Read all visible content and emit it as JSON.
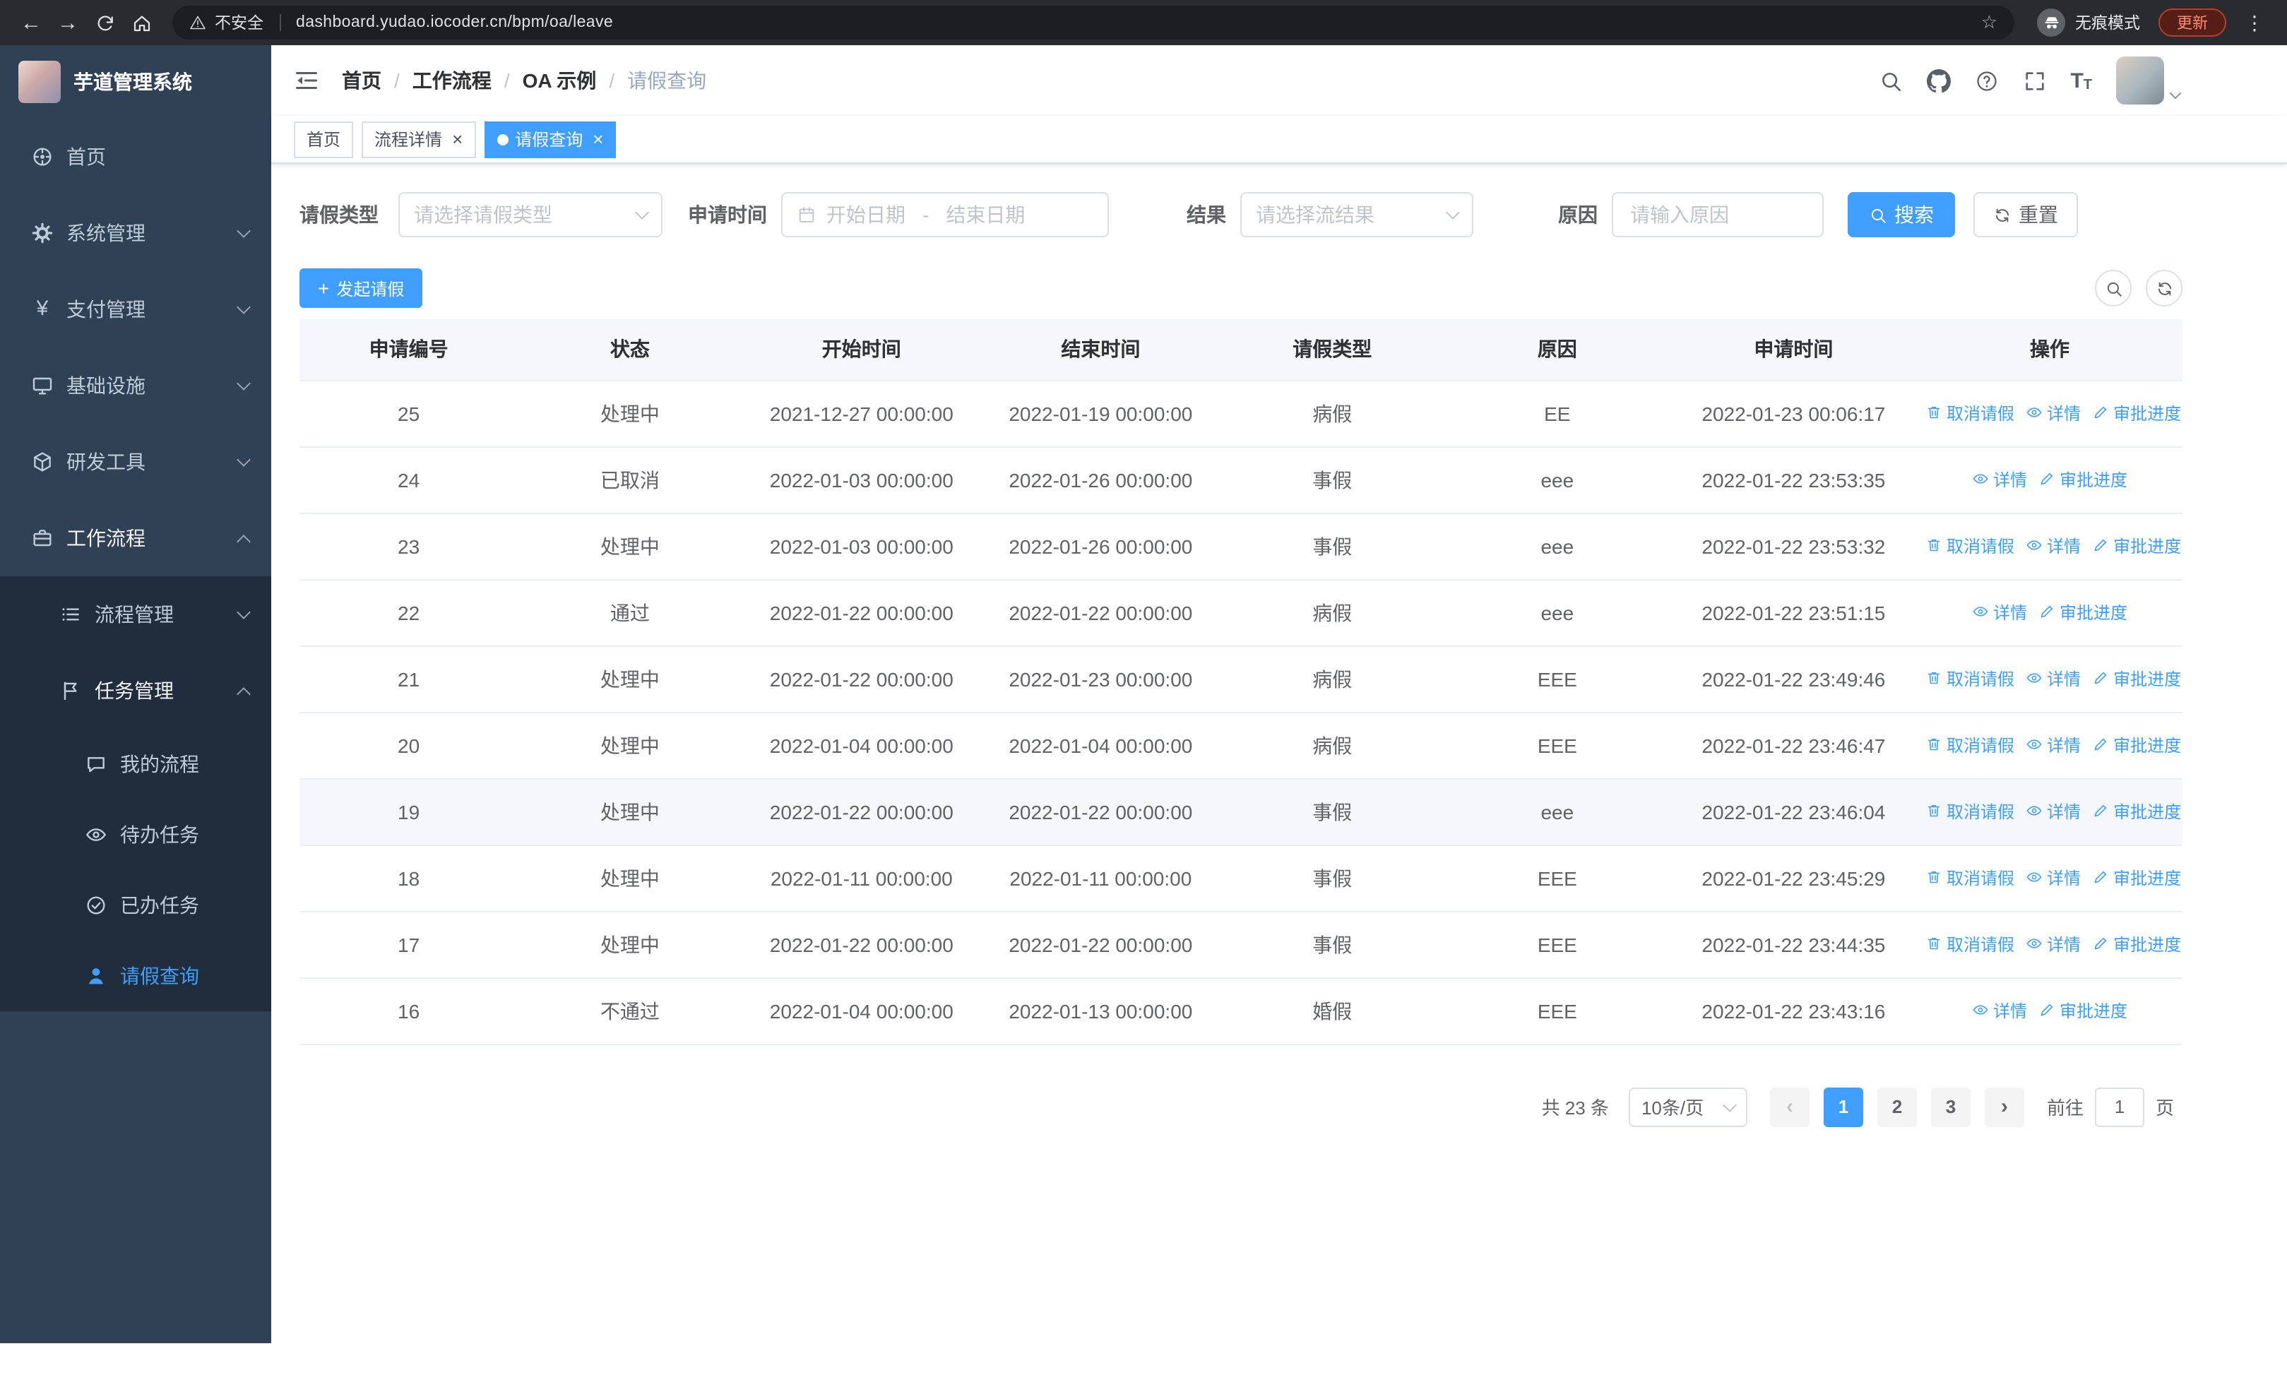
{
  "colors": {
    "accent": "#409eff",
    "sidebar_bg": "#304156",
    "sidebar_submenu_bg": "#1f2d3d",
    "sidebar_text": "#bfcbd9",
    "link": "#409eff",
    "active_tab_bg": "#409eff"
  },
  "browser": {
    "security_label": "不安全",
    "url": "dashboard.yudao.iocoder.cn/bpm/oa/leave",
    "incognito_label": "无痕模式",
    "update_label": "更新"
  },
  "sidebar": {
    "logo_title": "芋道管理系统",
    "menu": [
      {
        "key": "home",
        "label": "首页",
        "icon": "dashboard-icon",
        "level": 1
      },
      {
        "key": "system",
        "label": "系统管理",
        "icon": "gear-icon",
        "level": 1,
        "arrow": "down"
      },
      {
        "key": "payment",
        "label": "支付管理",
        "icon": "yen-icon",
        "level": 1,
        "arrow": "down"
      },
      {
        "key": "infrastructure",
        "label": "基础设施",
        "icon": "monitor-icon",
        "level": 1,
        "arrow": "down"
      },
      {
        "key": "devtools",
        "label": "研发工具",
        "icon": "cube-icon",
        "level": 1,
        "arrow": "down"
      },
      {
        "key": "workflow",
        "label": "工作流程",
        "icon": "briefcase-icon",
        "level": 1,
        "arrow": "up",
        "expanded": true
      },
      {
        "key": "process-management",
        "label": "流程管理",
        "icon": "list-icon",
        "level": 2,
        "arrow": "down"
      },
      {
        "key": "task-management",
        "label": "任务管理",
        "icon": "flag-icon",
        "level": 2,
        "arrow": "up",
        "expanded": true
      },
      {
        "key": "my-process",
        "label": "我的流程",
        "icon": "chat-icon",
        "level": 3
      },
      {
        "key": "todo-task",
        "label": "待办任务",
        "icon": "eye-icon",
        "level": 3
      },
      {
        "key": "done-task",
        "label": "已办任务",
        "icon": "check-circle-icon",
        "level": 3
      },
      {
        "key": "leave-query",
        "label": "请假查询",
        "icon": "user-icon",
        "level": 3,
        "active": true
      }
    ]
  },
  "header": {
    "breadcrumb": [
      "首页",
      "工作流程",
      "OA 示例",
      "请假查询"
    ],
    "icons": [
      "search-icon",
      "github-icon",
      "question-icon",
      "fullscreen-icon",
      "font-size-icon"
    ]
  },
  "tabs": [
    {
      "key": "home",
      "label": "首页",
      "closable": false,
      "active": false
    },
    {
      "key": "process-detail",
      "label": "流程详情",
      "closable": true,
      "active": false
    },
    {
      "key": "leave-query",
      "label": "请假查询",
      "closable": true,
      "active": true
    }
  ],
  "filters": {
    "leave_type": {
      "label": "请假类型",
      "placeholder": "请选择请假类型"
    },
    "apply_time": {
      "label": "申请时间",
      "start_placeholder": "开始日期",
      "separator": "-",
      "end_placeholder": "结束日期"
    },
    "result": {
      "label": "结果",
      "placeholder": "请选择流结果"
    },
    "reason": {
      "label": "原因",
      "placeholder": "请输入原因"
    },
    "search_label": "搜索",
    "reset_label": "重置"
  },
  "toolbar": {
    "create_label": "发起请假"
  },
  "table": {
    "columns": [
      "申请编号",
      "状态",
      "开始时间",
      "结束时间",
      "请假类型",
      "原因",
      "申请时间",
      "操作"
    ],
    "action_defs": {
      "cancel": {
        "label": "取消请假",
        "icon": "delete-icon"
      },
      "detail": {
        "label": "详情",
        "icon": "view-icon"
      },
      "progress": {
        "label": "审批进度",
        "icon": "edit-icon"
      }
    },
    "rows": [
      {
        "id": "25",
        "status": "处理中",
        "start": "2021-12-27 00:00:00",
        "end": "2022-01-19 00:00:00",
        "type": "病假",
        "reason": "EE",
        "applied": "2022-01-23 00:06:17",
        "actions": [
          "cancel",
          "detail",
          "progress"
        ]
      },
      {
        "id": "24",
        "status": "已取消",
        "start": "2022-01-03 00:00:00",
        "end": "2022-01-26 00:00:00",
        "type": "事假",
        "reason": "eee",
        "applied": "2022-01-22 23:53:35",
        "actions": [
          "detail",
          "progress"
        ]
      },
      {
        "id": "23",
        "status": "处理中",
        "start": "2022-01-03 00:00:00",
        "end": "2022-01-26 00:00:00",
        "type": "事假",
        "reason": "eee",
        "applied": "2022-01-22 23:53:32",
        "actions": [
          "cancel",
          "detail",
          "progress"
        ]
      },
      {
        "id": "22",
        "status": "通过",
        "start": "2022-01-22 00:00:00",
        "end": "2022-01-22 00:00:00",
        "type": "病假",
        "reason": "eee",
        "applied": "2022-01-22 23:51:15",
        "actions": [
          "detail",
          "progress"
        ]
      },
      {
        "id": "21",
        "status": "处理中",
        "start": "2022-01-22 00:00:00",
        "end": "2022-01-23 00:00:00",
        "type": "病假",
        "reason": "EEE",
        "applied": "2022-01-22 23:49:46",
        "actions": [
          "cancel",
          "detail",
          "progress"
        ]
      },
      {
        "id": "20",
        "status": "处理中",
        "start": "2022-01-04 00:00:00",
        "end": "2022-01-04 00:00:00",
        "type": "病假",
        "reason": "EEE",
        "applied": "2022-01-22 23:46:47",
        "actions": [
          "cancel",
          "detail",
          "progress"
        ]
      },
      {
        "id": "19",
        "status": "处理中",
        "start": "2022-01-22 00:00:00",
        "end": "2022-01-22 00:00:00",
        "type": "事假",
        "reason": "eee",
        "applied": "2022-01-22 23:46:04",
        "actions": [
          "cancel",
          "detail",
          "progress"
        ],
        "highlighted": true
      },
      {
        "id": "18",
        "status": "处理中",
        "start": "2022-01-11 00:00:00",
        "end": "2022-01-11 00:00:00",
        "type": "事假",
        "reason": "EEE",
        "applied": "2022-01-22 23:45:29",
        "actions": [
          "cancel",
          "detail",
          "progress"
        ]
      },
      {
        "id": "17",
        "status": "处理中",
        "start": "2022-01-22 00:00:00",
        "end": "2022-01-22 00:00:00",
        "type": "事假",
        "reason": "EEE",
        "applied": "2022-01-22 23:44:35",
        "actions": [
          "cancel",
          "detail",
          "progress"
        ]
      },
      {
        "id": "16",
        "status": "不通过",
        "start": "2022-01-04 00:00:00",
        "end": "2022-01-13 00:00:00",
        "type": "婚假",
        "reason": "EEE",
        "applied": "2022-01-22 23:43:16",
        "actions": [
          "detail",
          "progress"
        ]
      }
    ]
  },
  "pagination": {
    "total_text": "共 23 条",
    "page_size": "10条/页",
    "pages": [
      "1",
      "2",
      "3"
    ],
    "active_page": "1",
    "goto_label": "前往",
    "goto_value": "1",
    "page_suffix": "页"
  }
}
